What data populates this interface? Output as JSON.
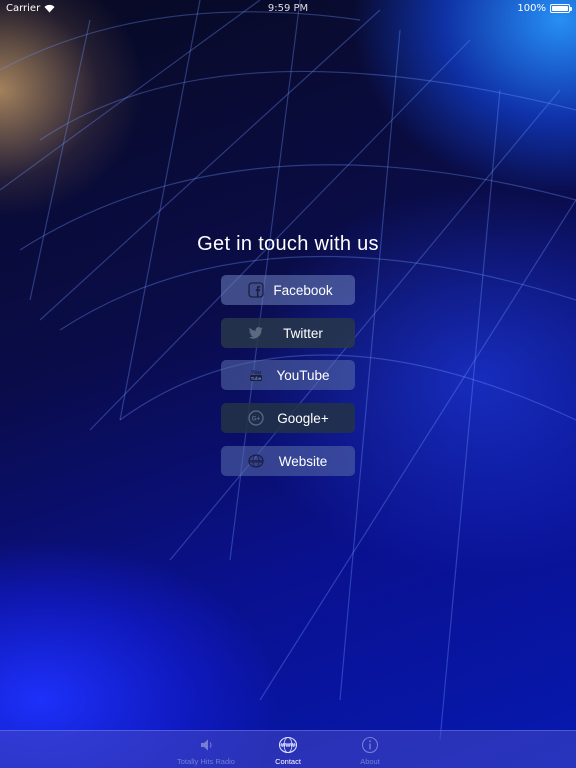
{
  "status_bar": {
    "carrier": "Carrier",
    "time": "9:59 PM",
    "battery": "100%"
  },
  "heading": "Get in touch with us",
  "buttons": [
    {
      "label": "Facebook",
      "icon": "facebook-icon"
    },
    {
      "label": "Twitter",
      "icon": "twitter-icon"
    },
    {
      "label": "YouTube",
      "icon": "youtube-icon"
    },
    {
      "label": "Google+",
      "icon": "google-plus-icon"
    },
    {
      "label": "Website",
      "icon": "www-icon"
    }
  ],
  "tabs": [
    {
      "label": "Totally Hits Radio",
      "icon": "speaker-icon",
      "active": false
    },
    {
      "label": "Contact",
      "icon": "www-globe-icon",
      "active": true
    },
    {
      "label": "About",
      "icon": "info-icon",
      "active": false
    }
  ],
  "colors": {
    "accent": "#0a1bd0",
    "button_bg": "#6e82be",
    "tab_active": "#ffffff"
  }
}
